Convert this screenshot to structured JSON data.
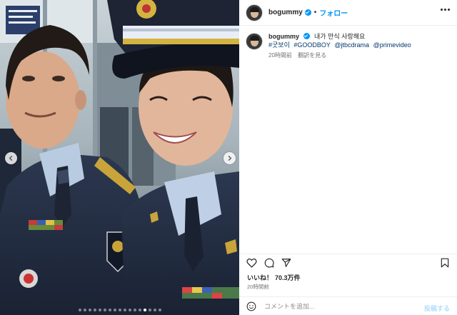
{
  "media": {
    "photo_description_icon": "photo-icon",
    "prev_icon": "chevron-left-icon",
    "next_icon": "chevron-right-icon",
    "carousel": {
      "total_slides": 17,
      "active_index": 13
    }
  },
  "header": {
    "username": "bogummy",
    "separator": "•",
    "follow_label": "フォロー"
  },
  "caption": {
    "username": "bogummy",
    "text": "내가 만식 사랑해요",
    "tags": [
      "#굿보이",
      "#GOODBOY",
      "@jtbcdrama",
      "@primevideo"
    ],
    "time": "20時間前",
    "translate_label": "翻訳を見る"
  },
  "actions": {
    "likes_label": "いいね！",
    "likes_count": "70.3万件",
    "posted": "20時間前"
  },
  "comment": {
    "placeholder": "コメントを追加...",
    "post_label": "投稿する"
  },
  "colors": {
    "accent": "#0095f6",
    "link": "#00376b",
    "muted": "#737373",
    "post_disabled": "#b2dffc"
  }
}
